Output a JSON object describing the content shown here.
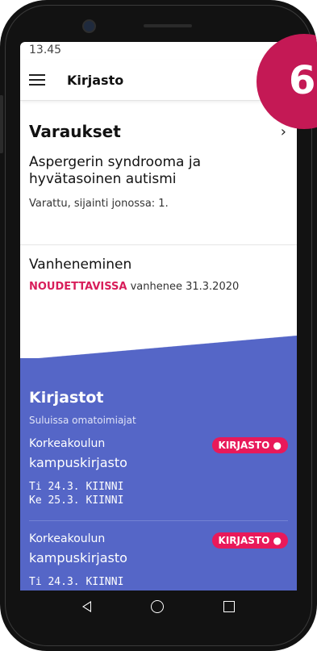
{
  "status_bar": {
    "time": "13.45"
  },
  "app_bar": {
    "title": "Kirjasto"
  },
  "reservations": {
    "title": "Varaukset",
    "book_title": "Aspergerin syndrooma ja hyvätasoinen autismi",
    "status": "Varattu, sijainti jonossa: 1."
  },
  "renewal": {
    "title": "Vanheneminen",
    "highlight": "NOUDETTAVISSA",
    "rest": " vanhenee 31.3.2020"
  },
  "libraries": {
    "title": "Kirjastot",
    "subtitle": "Suluissa omatoimiajat",
    "items": [
      {
        "name_line1": "Korkeakoulun",
        "name_line2": "kampuskirjasto",
        "tag": "KIRJASTO",
        "hours": [
          "Ti 24.3. KIINNI",
          "Ke 25.3. KIINNI"
        ]
      },
      {
        "name_line1": "Korkeakoulun",
        "name_line2": "kampuskirjasto",
        "tag": "KIRJASTO",
        "hours": [
          "Ti 24.3. KIINNI"
        ]
      }
    ]
  },
  "badge": {
    "number": "6"
  },
  "colors": {
    "accent": "#d81e5b",
    "blue_panel": "#5566c7",
    "badge": "#c41955"
  }
}
